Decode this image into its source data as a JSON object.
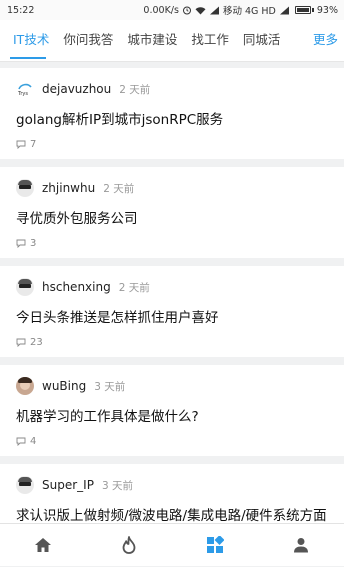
{
  "status_bar": {
    "time": "15:22",
    "speed": "0.00K/s",
    "carrier": "移动 4G HD",
    "battery": "93%"
  },
  "tabs": [
    {
      "label": "IT技术",
      "active": true
    },
    {
      "label": "你问我答",
      "active": false
    },
    {
      "label": "城市建设",
      "active": false
    },
    {
      "label": "找工作",
      "active": false
    },
    {
      "label": "同城活",
      "active": false
    }
  ],
  "more_label": "更多",
  "posts": [
    {
      "author": "dejavuzhou",
      "time": "2 天前",
      "title": "golang解析IP到城市jsonRPC服务",
      "comments": "7",
      "avatar": "logo-avatar"
    },
    {
      "author": "zhjinwhu",
      "time": "2 天前",
      "title": "寻优质外包服务公司",
      "comments": "3",
      "avatar": "glasses-avatar"
    },
    {
      "author": "hschenxing",
      "time": "2 天前",
      "title": "今日头条推送是怎样抓住用户喜好",
      "comments": "23",
      "avatar": "glasses-avatar"
    },
    {
      "author": "wuBing",
      "time": "3 天前",
      "title": "机器学习的工作具体是做什么?",
      "comments": "4",
      "avatar": "photo-avatar"
    },
    {
      "author": "Super_IP",
      "time": "3 天前",
      "title": "求认识版上做射频/微波电路/集成电路/硬件系统方面的大大",
      "comments": "",
      "avatar": "glasses-avatar"
    }
  ],
  "colors": {
    "accent": "#2d9be8",
    "nav_icon": "#555555"
  },
  "bottom_nav": [
    {
      "icon": "home-icon",
      "active": false
    },
    {
      "icon": "flame-icon",
      "active": false
    },
    {
      "icon": "grid-icon",
      "active": true
    },
    {
      "icon": "profile-icon",
      "active": false
    }
  ]
}
